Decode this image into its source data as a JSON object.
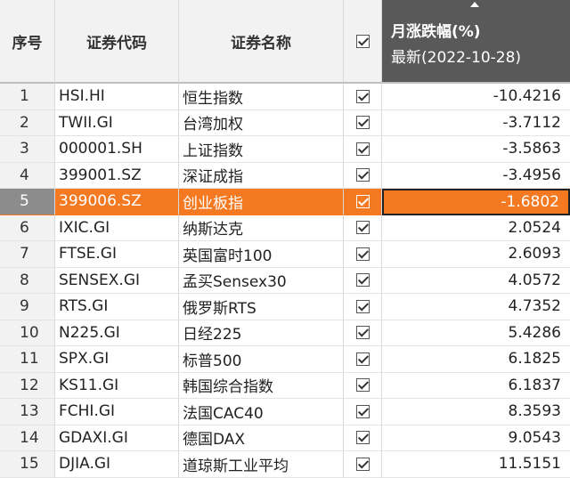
{
  "header": {
    "seq": "序号",
    "code": "证券代码",
    "name": "证券名称",
    "change_title": "月涨跌幅(%)",
    "change_subtitle": "最新(2022-10-28)"
  },
  "colors": {
    "selected_row": "#f47920",
    "header_active": "#595959"
  },
  "rows": [
    {
      "seq": "1",
      "code": "HSI.HI",
      "name": "恒生指数",
      "change": "-10.4216",
      "checked": true
    },
    {
      "seq": "2",
      "code": "TWII.GI",
      "name": "台湾加权",
      "change": "-3.7112",
      "checked": true
    },
    {
      "seq": "3",
      "code": "000001.SH",
      "name": "上证指数",
      "change": "-3.5863",
      "checked": true
    },
    {
      "seq": "4",
      "code": "399001.SZ",
      "name": "深证成指",
      "change": "-3.4956",
      "checked": true
    },
    {
      "seq": "5",
      "code": "399006.SZ",
      "name": "创业板指",
      "change": "-1.6802",
      "checked": true,
      "selected": true
    },
    {
      "seq": "6",
      "code": "IXIC.GI",
      "name": "纳斯达克",
      "change": "2.0524",
      "checked": true
    },
    {
      "seq": "7",
      "code": "FTSE.GI",
      "name": "英国富时100",
      "change": "2.6093",
      "checked": true
    },
    {
      "seq": "8",
      "code": "SENSEX.GI",
      "name": "孟买Sensex30",
      "change": "4.0572",
      "checked": true
    },
    {
      "seq": "9",
      "code": "RTS.GI",
      "name": "俄罗斯RTS",
      "change": "4.7352",
      "checked": true
    },
    {
      "seq": "10",
      "code": "N225.GI",
      "name": "日经225",
      "change": "5.4286",
      "checked": true
    },
    {
      "seq": "11",
      "code": "SPX.GI",
      "name": "标普500",
      "change": "6.1825",
      "checked": true
    },
    {
      "seq": "12",
      "code": "KS11.GI",
      "name": "韩国综合指数",
      "change": "6.1837",
      "checked": true
    },
    {
      "seq": "13",
      "code": "FCHI.GI",
      "name": "法国CAC40",
      "change": "8.3593",
      "checked": true
    },
    {
      "seq": "14",
      "code": "GDAXI.GI",
      "name": "德国DAX",
      "change": "9.0543",
      "checked": true
    },
    {
      "seq": "15",
      "code": "DJIA.GI",
      "name": "道琼斯工业平均",
      "change": "11.5151",
      "checked": true
    }
  ]
}
